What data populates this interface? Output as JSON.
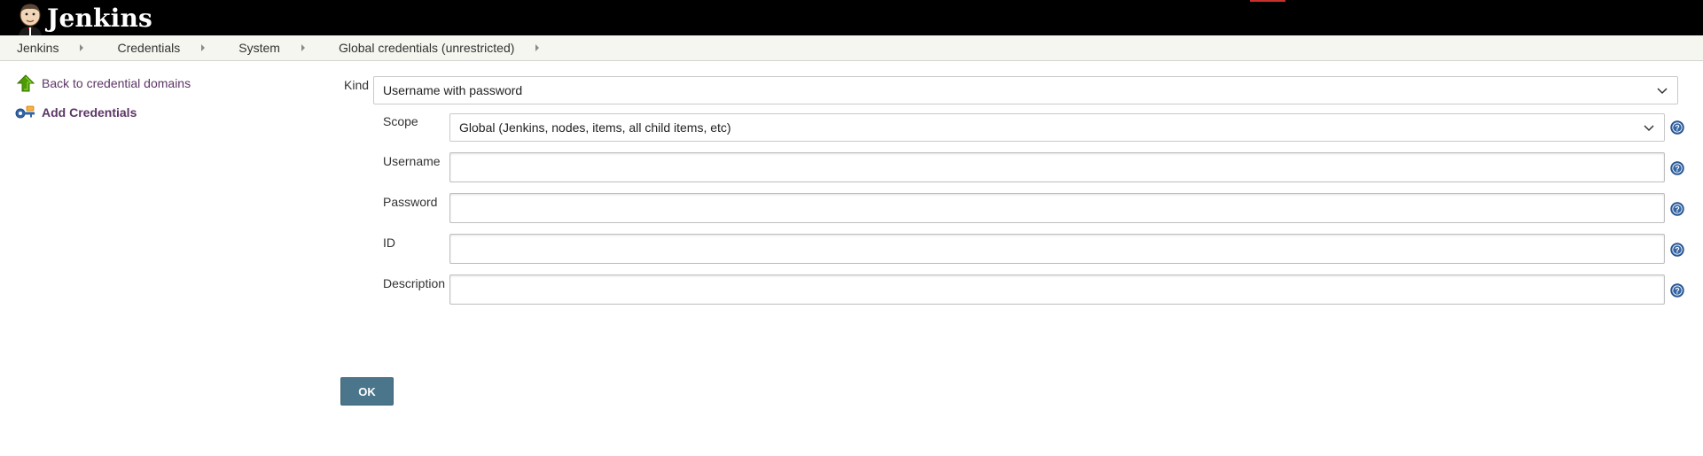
{
  "header": {
    "brand": "Jenkins",
    "logo_icon": "jenkins-butler-icon",
    "background": "#000000"
  },
  "breadcrumbs": [
    {
      "label": "Jenkins"
    },
    {
      "label": "Credentials"
    },
    {
      "label": "System"
    },
    {
      "label": "Global credentials (unrestricted)"
    }
  ],
  "side_panel": {
    "tasks": [
      {
        "label": "Back to credential domains",
        "icon": "up-arrow-icon"
      },
      {
        "label": "Add Credentials",
        "icon": "key-icon"
      }
    ]
  },
  "form": {
    "kind": {
      "label": "Kind",
      "value": "Username with password"
    },
    "scope": {
      "label": "Scope",
      "value": "Global (Jenkins, nodes, items, all child items, etc)"
    },
    "username": {
      "label": "Username",
      "value": ""
    },
    "password": {
      "label": "Password",
      "value": ""
    },
    "id": {
      "label": "ID",
      "value": ""
    },
    "description": {
      "label": "Description",
      "value": ""
    },
    "ok_label": "OK"
  },
  "colors": {
    "link": "#5c3566",
    "ok_button": "#4b758b",
    "help_icon": "#204a87",
    "breadcrumb_bg": "#f6f6f0"
  }
}
